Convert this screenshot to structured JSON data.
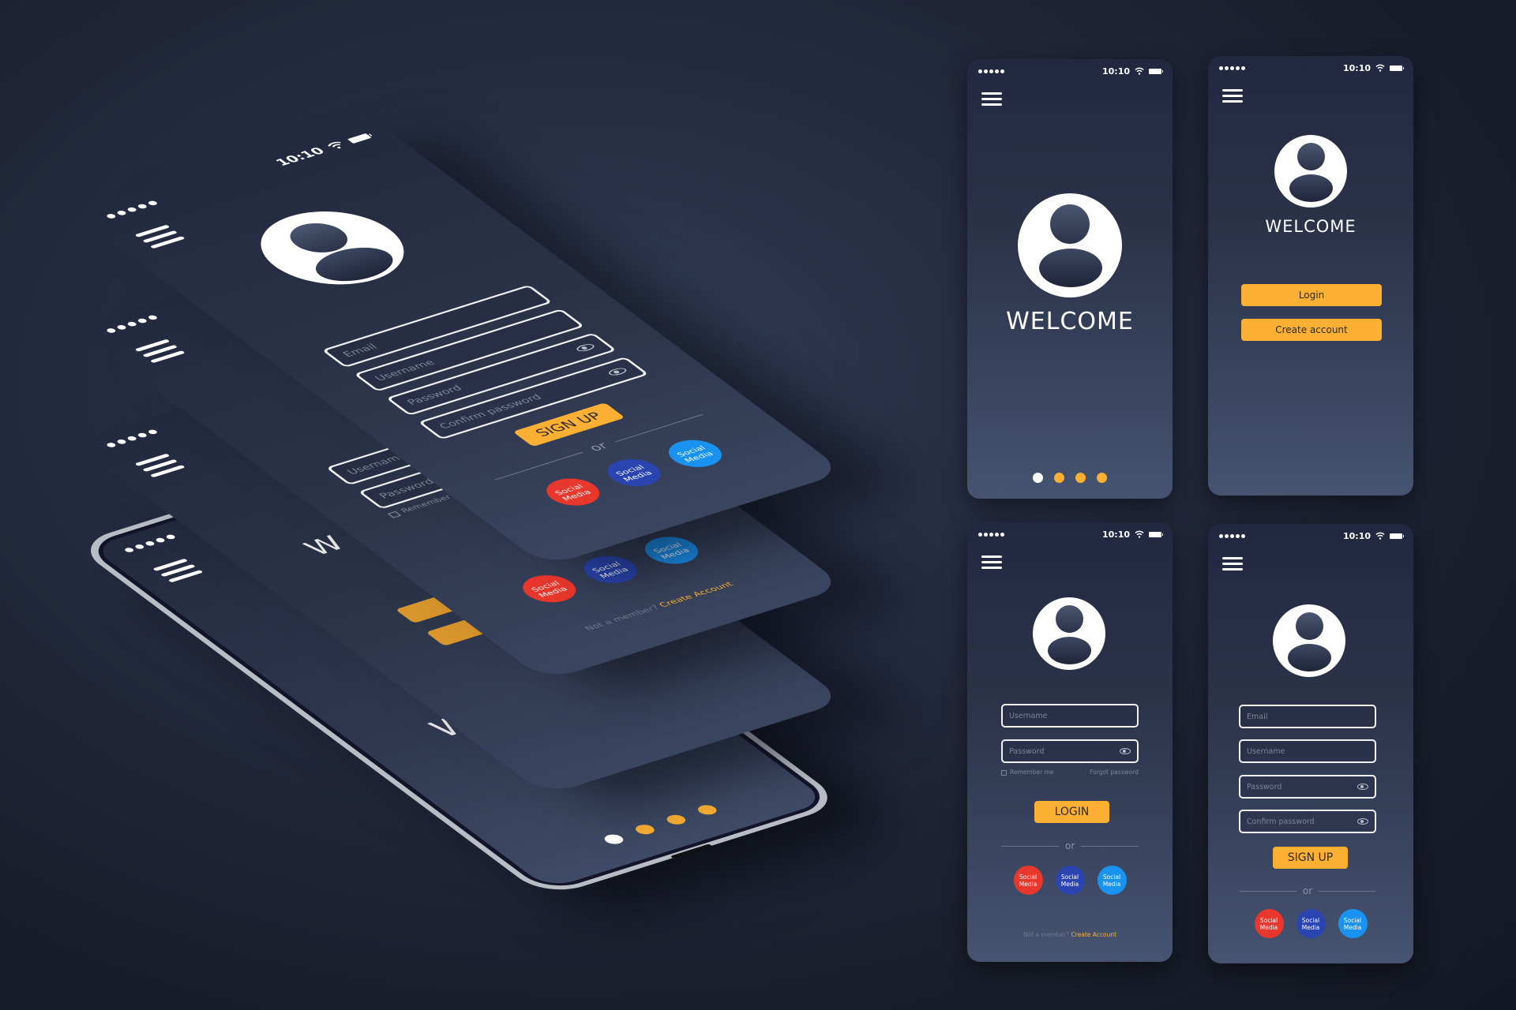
{
  "status_bar": {
    "time": "10:10",
    "signal_dots": 5,
    "icons": [
      "signal-dots-icon",
      "wifi-icon",
      "battery-icon"
    ]
  },
  "colors": {
    "accent": "#fbb034",
    "social_red": "#e8372c",
    "social_navy": "#2a45b0",
    "social_blue": "#1a93f0",
    "dot_active": "#ffffff",
    "field_border": "#f2f2f2",
    "placeholder": "#7d8699"
  },
  "splash_screen": {
    "title": "WELCOME",
    "pager": {
      "total": 4,
      "active_index": 0
    }
  },
  "welcome_screen": {
    "title": "WELCOME",
    "login_button": "Login",
    "create_account_button": "Create account"
  },
  "login_screen": {
    "username_placeholder": "Username",
    "password_placeholder": "Password",
    "remember_me": "Remember me",
    "forgot_password": "Forgot password",
    "login_button": "LOGIN",
    "or_label": "or",
    "social_buttons": [
      {
        "label_line1": "Social",
        "label_line2": "Media",
        "color": "red"
      },
      {
        "label_line1": "Social",
        "label_line2": "Media",
        "color": "navy"
      },
      {
        "label_line1": "Social",
        "label_line2": "Media",
        "color": "blue"
      }
    ],
    "footer_prefix": "Not a member?",
    "footer_link": "Create Account"
  },
  "signup_screen": {
    "email_placeholder": "Email",
    "username_placeholder": "Username",
    "password_placeholder": "Password",
    "confirm_password_placeholder": "Confirm password",
    "signup_button": "SIGN UP",
    "or_label": "or",
    "social_buttons": [
      {
        "label_line1": "Social",
        "label_line2": "Media",
        "color": "red"
      },
      {
        "label_line1": "Social",
        "label_line2": "Media",
        "color": "navy"
      },
      {
        "label_line1": "Social",
        "label_line2": "Media",
        "color": "blue"
      }
    ]
  },
  "iso_stack": {
    "layers": [
      "signup",
      "login",
      "welcome",
      "splash-device"
    ],
    "partial_welcome_letter": "W"
  }
}
